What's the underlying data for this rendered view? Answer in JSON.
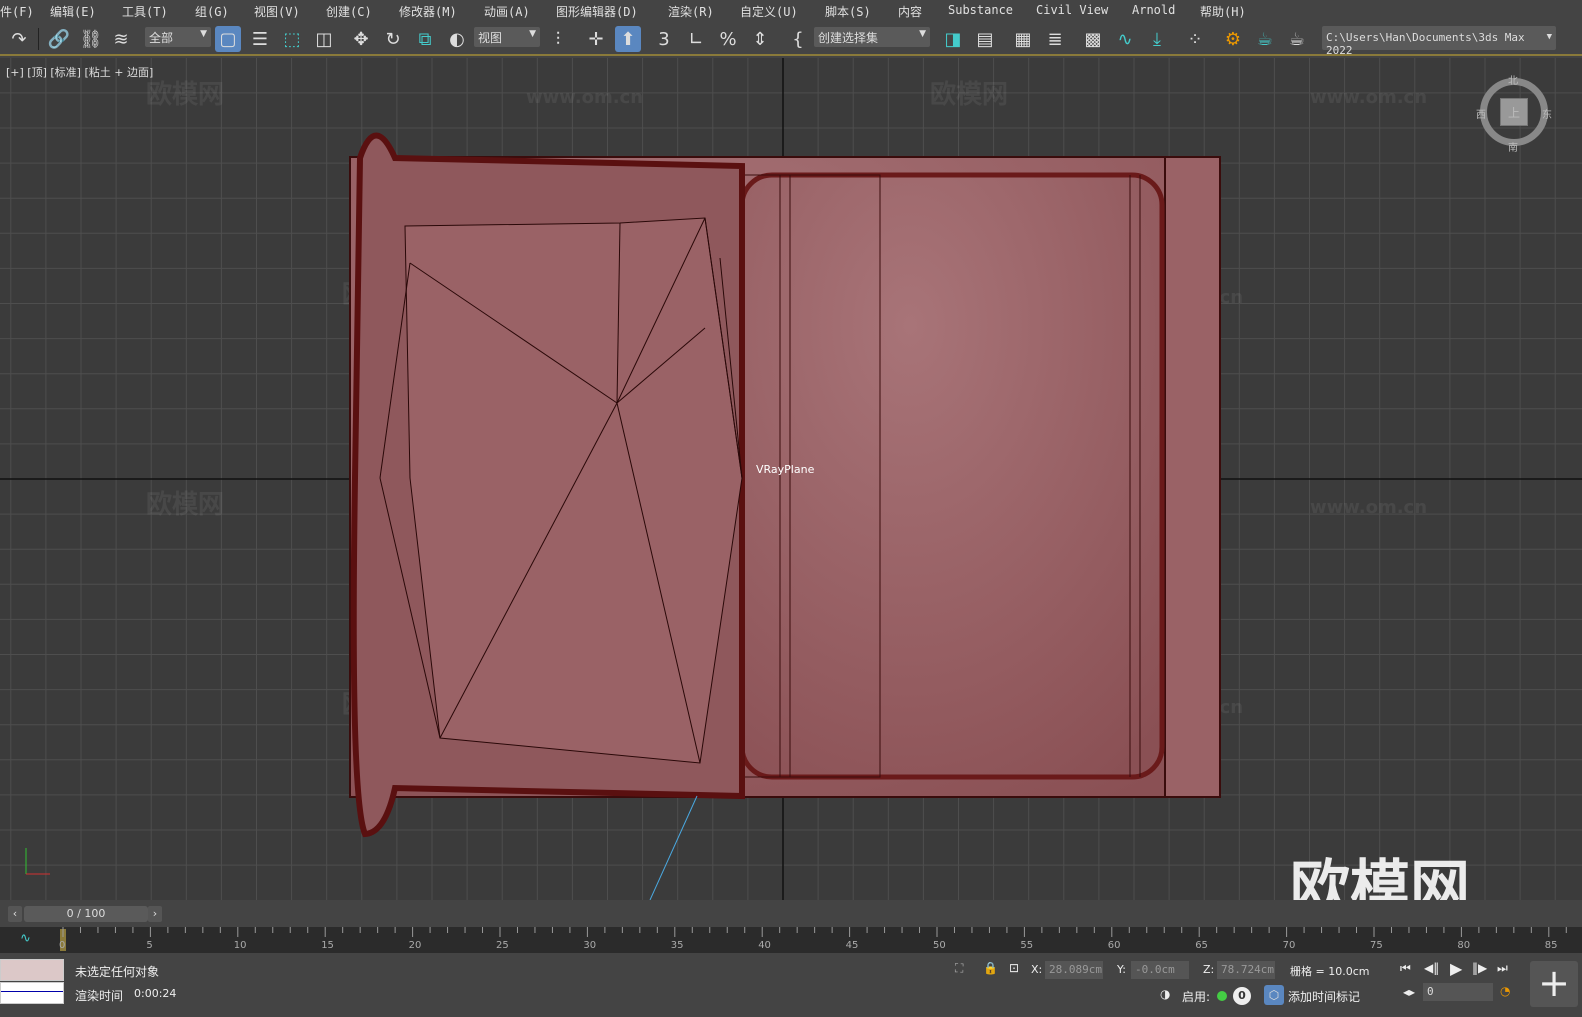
{
  "menubar": {
    "items": [
      "件(F)",
      "编辑(E)",
      "工具(T)",
      "组(G)",
      "视图(V)",
      "创建(C)",
      "修改器(M)",
      "动画(A)",
      "图形编辑器(D)",
      "渲染(R)",
      "自定义(U)",
      "脚本(S)",
      "内容",
      "Substance",
      "Civil View",
      "Arnold",
      "帮助(H)"
    ]
  },
  "toolbar": {
    "selection_filter": "全部",
    "ref_coord": "视图",
    "named_selection": "创建选择集",
    "project_path": "C:\\Users\\Han\\Documents\\3ds Max 2022"
  },
  "viewport": {
    "label": "[+] [顶] [标准] [粘土 + 边面]",
    "object_label": "VRayPlane",
    "viewcube": {
      "face": "上",
      "north": "北",
      "south": "南",
      "east": "东",
      "west": "西"
    },
    "watermark_text": "欧模网",
    "watermark_url": "www.om.cn",
    "axis_colors": {
      "x": "#d03030",
      "y": "#30c030"
    }
  },
  "timeline": {
    "current": "0 / 100",
    "start": 0,
    "end": 100,
    "tick_labels": [
      0,
      5,
      10,
      15,
      20,
      25,
      30,
      35,
      40,
      45,
      50,
      55,
      60,
      65,
      70,
      75,
      80,
      85
    ]
  },
  "status": {
    "selection": "未选定任何对象",
    "render_time_label": "渲染时间",
    "render_time": "0:00:24",
    "x_label": "X:",
    "x": "28.089cm",
    "y_label": "Y:",
    "y": "-0.0cm",
    "z_label": "Z:",
    "z": "78.724cm",
    "grid": "栅格 = 10.0cm",
    "enable_label": "启用:",
    "enable_count": "0",
    "add_time_tag": "添加时间标记",
    "frame": "0"
  },
  "colors": {
    "accent": "#5a87c0",
    "object": "#9a6266",
    "timeline_marker": "#8a7a3a"
  }
}
